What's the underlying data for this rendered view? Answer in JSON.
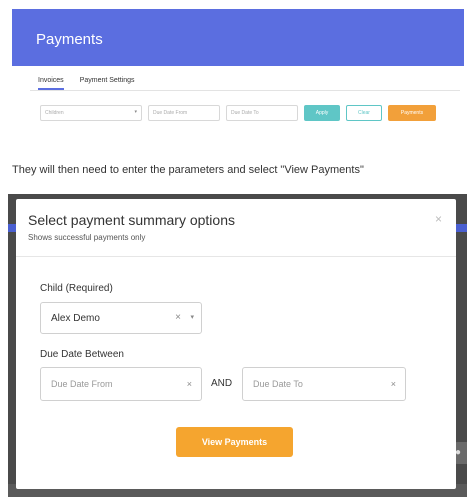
{
  "app": {
    "title": "Payments",
    "tabs": [
      {
        "label": "Invoices"
      },
      {
        "label": "Payment Settings"
      }
    ],
    "filters": {
      "child_placeholder": "Children",
      "due_from_placeholder": "Due Date From",
      "due_to_placeholder": "Due Date To",
      "apply_label": "Apply",
      "clear_label": "Clear",
      "payments_label": "Payments"
    },
    "colors": {
      "header": "#5b6ee0",
      "apply": "#5fc6c6",
      "payments": "#f2a03a"
    }
  },
  "caption": "They will then need to enter the parameters and select \"View Payments\"",
  "modal": {
    "title": "Select payment summary options",
    "subtitle": "Shows successful payments only",
    "close_glyph": "×",
    "child_label": "Child (Required)",
    "child_value": "Alex Demo",
    "clear_glyph": "×",
    "caret_glyph": "▾",
    "due_label": "Due Date Between",
    "due_from_placeholder": "Due Date From",
    "due_to_placeholder": "Due Date To",
    "and_label": "AND",
    "view_button": "View Payments",
    "colors": {
      "view_button": "#f5a52f"
    }
  },
  "icons": {
    "close": "close-icon",
    "clear": "clear-icon",
    "caret": "chevron-down-icon"
  }
}
